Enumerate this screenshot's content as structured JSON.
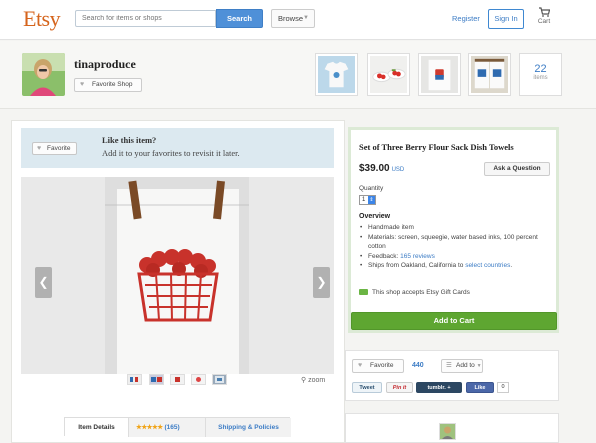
{
  "header": {
    "logo": "Etsy",
    "search_placeholder": "Search for items or shops",
    "search_button": "Search",
    "browse": "Browse",
    "register": "Register",
    "sign_in": "Sign In",
    "cart": "Cart"
  },
  "shop": {
    "name": "tinaproduce",
    "favorite_shop": "Favorite Shop",
    "items_count": "22",
    "items_label": "items"
  },
  "banner": {
    "favorite_button": "Favorite",
    "title": "Like this item?",
    "subtitle": "Add it to your favorites to revisit it later."
  },
  "gallery": {
    "zoom": "zoom"
  },
  "tabs": {
    "details": "Item Details",
    "stars": "★★★★★",
    "reviews": "(165)",
    "shipping": "Shipping & Policies"
  },
  "listing": {
    "title": "Set of Three Berry Flour Sack Dish Towels",
    "price": "$39.00",
    "currency": "USD",
    "ask_question": "Ask a Question",
    "quantity_label": "Quantity",
    "quantity_value": "1",
    "overview_title": "Overview",
    "overview": {
      "handmade": "Handmade item",
      "materials": "Materials: screen, squeegie, water based inks, 100 percent cotton",
      "feedback_prefix": "Feedback: ",
      "feedback_link": "165 reviews",
      "ships_prefix": "Ships from Oakland, California to ",
      "ships_link": "select countries",
      "ships_suffix": "."
    },
    "gift_cards": "This shop accepts Etsy Gift Cards",
    "add_to_cart": "Add to Cart"
  },
  "social": {
    "favorite": "Favorite",
    "favorite_count": "440",
    "add_to": "Add to",
    "tweet": "Tweet",
    "pin": "Pin it",
    "tumblr": "tumblr. +",
    "like": "Like",
    "like_count": "0"
  },
  "colors": {
    "brand": "#d5641c",
    "link": "#3c7cc5",
    "cart_button": "#5ea631"
  }
}
